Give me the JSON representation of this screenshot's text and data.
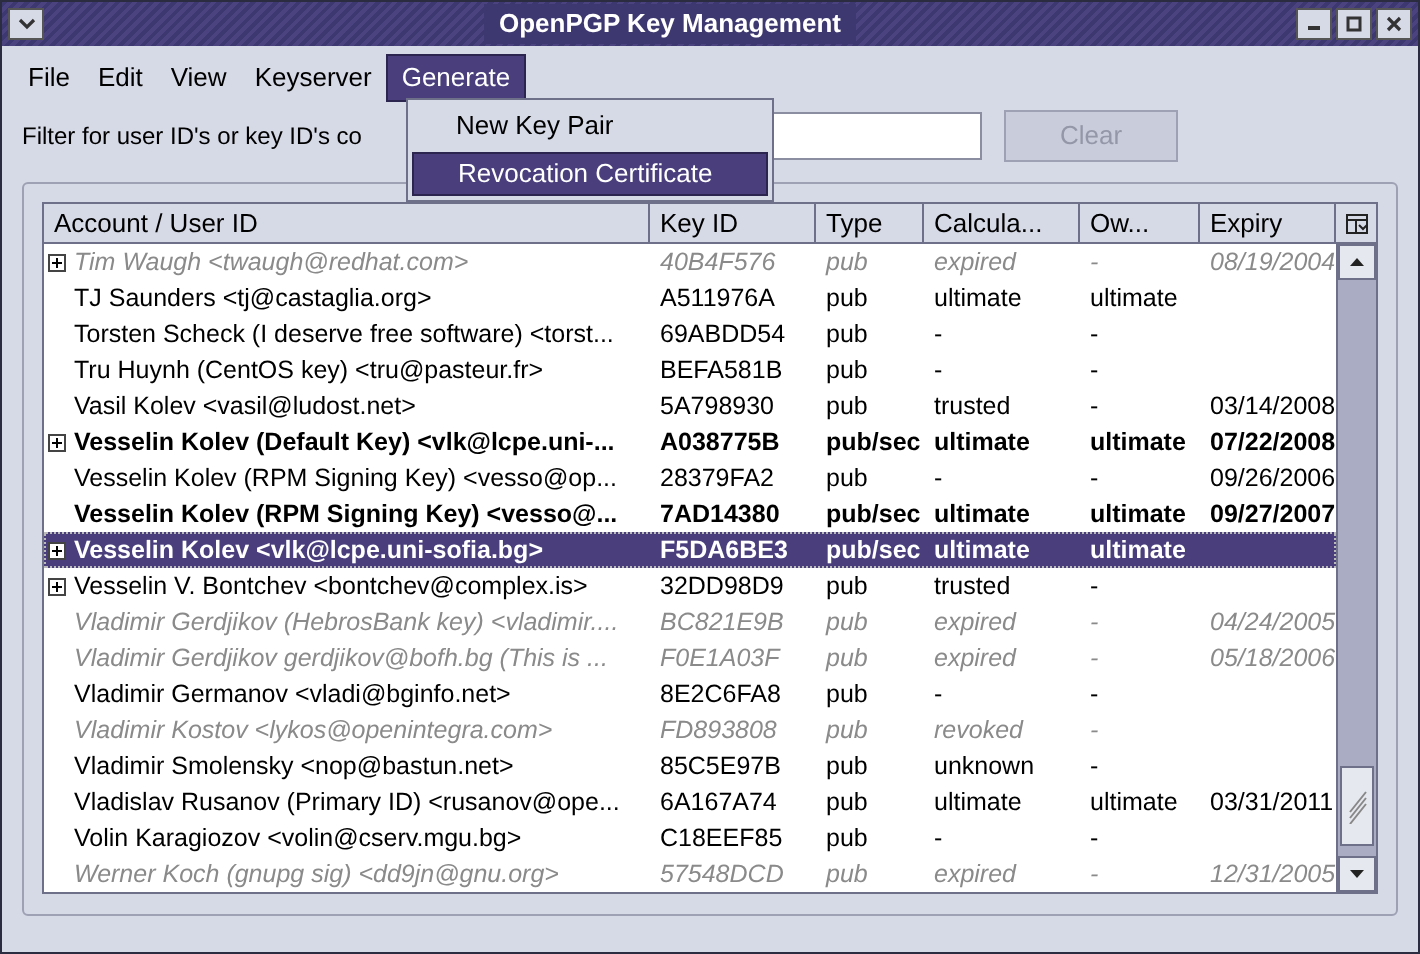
{
  "window": {
    "title": "OpenPGP Key Management"
  },
  "menu": [
    {
      "label": "File",
      "selected": false
    },
    {
      "label": "Edit",
      "selected": false
    },
    {
      "label": "View",
      "selected": false
    },
    {
      "label": "Keyserver",
      "selected": false
    },
    {
      "label": "Generate",
      "selected": true
    }
  ],
  "dropdown": [
    {
      "label": "New Key Pair",
      "selected": false
    },
    {
      "label": "Revocation Certificate",
      "selected": true
    }
  ],
  "filter": {
    "label": "Filter for user ID's or key ID's co",
    "button": "Clear",
    "button_disabled": true
  },
  "table": {
    "columns": [
      "Account / User ID",
      "Key ID",
      "Type",
      "Calcula...",
      "Ow...",
      "Expiry"
    ],
    "rows": [
      {
        "cells": [
          "Tim Waugh <twaugh@redhat.com>",
          "40B4F576",
          "pub",
          "expired",
          "-",
          "08/19/2004"
        ],
        "expandable": true,
        "kind": "invalid",
        "selected": false
      },
      {
        "cells": [
          "TJ Saunders <tj@castaglia.org>",
          "A511976A",
          "pub",
          "ultimate",
          "ultimate",
          ""
        ],
        "expandable": false,
        "kind": "normal",
        "selected": false
      },
      {
        "cells": [
          "Torsten Scheck (I deserve free software) <torst...",
          "69ABDD54",
          "pub",
          "-",
          "-",
          ""
        ],
        "expandable": false,
        "kind": "normal",
        "selected": false
      },
      {
        "cells": [
          "Tru Huynh (CentOS key) <tru@pasteur.fr>",
          "BEFA581B",
          "pub",
          "-",
          "-",
          ""
        ],
        "expandable": false,
        "kind": "normal",
        "selected": false
      },
      {
        "cells": [
          "Vasil Kolev <vasil@ludost.net>",
          "5A798930",
          "pub",
          "trusted",
          "-",
          "03/14/2008"
        ],
        "expandable": false,
        "kind": "normal",
        "selected": false
      },
      {
        "cells": [
          "Vesselin Kolev (Default Key) <vlk@lcpe.uni-...",
          "A038775B",
          "pub/sec",
          "ultimate",
          "ultimate",
          "07/22/2008"
        ],
        "expandable": true,
        "kind": "secret",
        "selected": false
      },
      {
        "cells": [
          "Vesselin Kolev (RPM Signing Key) <vesso@op...",
          "28379FA2",
          "pub",
          "-",
          "-",
          "09/26/2006"
        ],
        "expandable": false,
        "kind": "normal",
        "selected": false
      },
      {
        "cells": [
          "Vesselin Kolev (RPM Signing Key) <vesso@...",
          "7AD14380",
          "pub/sec",
          "ultimate",
          "ultimate",
          "09/27/2007"
        ],
        "expandable": false,
        "kind": "secret",
        "selected": false
      },
      {
        "cells": [
          "Vesselin Kolev <vlk@lcpe.uni-sofia.bg>",
          "F5DA6BE3",
          "pub/sec",
          "ultimate",
          "ultimate",
          ""
        ],
        "expandable": true,
        "kind": "secret",
        "selected": true
      },
      {
        "cells": [
          "Vesselin V. Bontchev <bontchev@complex.is>",
          "32DD98D9",
          "pub",
          "trusted",
          "-",
          ""
        ],
        "expandable": true,
        "kind": "normal",
        "selected": false
      },
      {
        "cells": [
          "Vladimir Gerdjikov (HebrosBank key) <vladimir....",
          "BC821E9B",
          "pub",
          "expired",
          "-",
          "04/24/2005"
        ],
        "expandable": false,
        "kind": "invalid",
        "selected": false
      },
      {
        "cells": [
          "Vladimir Gerdjikov gerdjikov@bofh.bg (This is ...",
          "F0E1A03F",
          "pub",
          "expired",
          "-",
          "05/18/2006"
        ],
        "expandable": false,
        "kind": "invalid",
        "selected": false
      },
      {
        "cells": [
          "Vladimir Germanov <vladi@bginfo.net>",
          "8E2C6FA8",
          "pub",
          "-",
          "-",
          ""
        ],
        "expandable": false,
        "kind": "normal",
        "selected": false
      },
      {
        "cells": [
          "Vladimir Kostov <lykos@openintegra.com>",
          "FD893808",
          "pub",
          "revoked",
          "-",
          ""
        ],
        "expandable": false,
        "kind": "invalid",
        "selected": false
      },
      {
        "cells": [
          "Vladimir Smolensky <nop@bastun.net>",
          "85C5E97B",
          "pub",
          "unknown",
          "-",
          ""
        ],
        "expandable": false,
        "kind": "normal",
        "selected": false
      },
      {
        "cells": [
          "Vladislav Rusanov (Primary ID) <rusanov@ope...",
          "6A167A74",
          "pub",
          "ultimate",
          "ultimate",
          "03/31/2011"
        ],
        "expandable": false,
        "kind": "normal",
        "selected": false
      },
      {
        "cells": [
          "Volin Karagiozov <volin@cserv.mgu.bg>",
          "C18EEF85",
          "pub",
          "-",
          "-",
          ""
        ],
        "expandable": false,
        "kind": "normal",
        "selected": false
      },
      {
        "cells": [
          "Werner Koch (gnupg sig) <dd9jn@gnu.org>",
          "57548DCD",
          "pub",
          "expired",
          "-",
          "12/31/2005"
        ],
        "expandable": false,
        "kind": "invalid",
        "selected": false
      }
    ]
  }
}
